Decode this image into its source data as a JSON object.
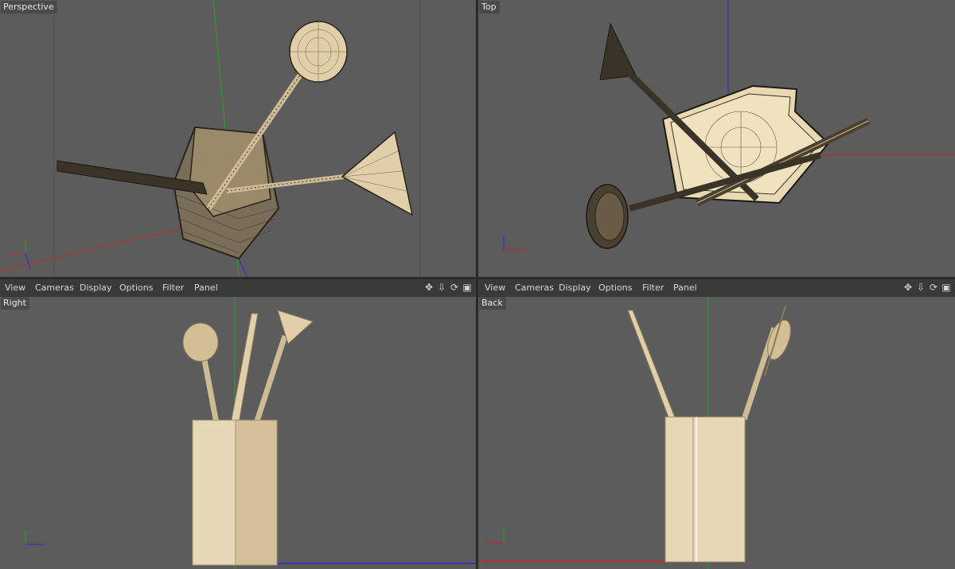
{
  "viewports": {
    "perspective": {
      "label": "Perspective"
    },
    "top": {
      "label": "Top"
    },
    "right": {
      "label": "Right"
    },
    "back": {
      "label": "Back"
    }
  },
  "menubar": {
    "items": [
      "View",
      "Cameras",
      "Display",
      "Options",
      "Filter",
      "Panel"
    ],
    "tools": [
      "move-view-icon",
      "zoom-view-icon",
      "rotate-view-icon",
      "toggle-layout-icon"
    ]
  },
  "colors": {
    "viewport_bg": "#5c5c5c",
    "menubar_bg": "#3a3a3a",
    "axis_x": "#c8282d",
    "axis_y": "#27a327",
    "axis_z": "#2a2ad0",
    "wood": "#e0cfa8"
  }
}
